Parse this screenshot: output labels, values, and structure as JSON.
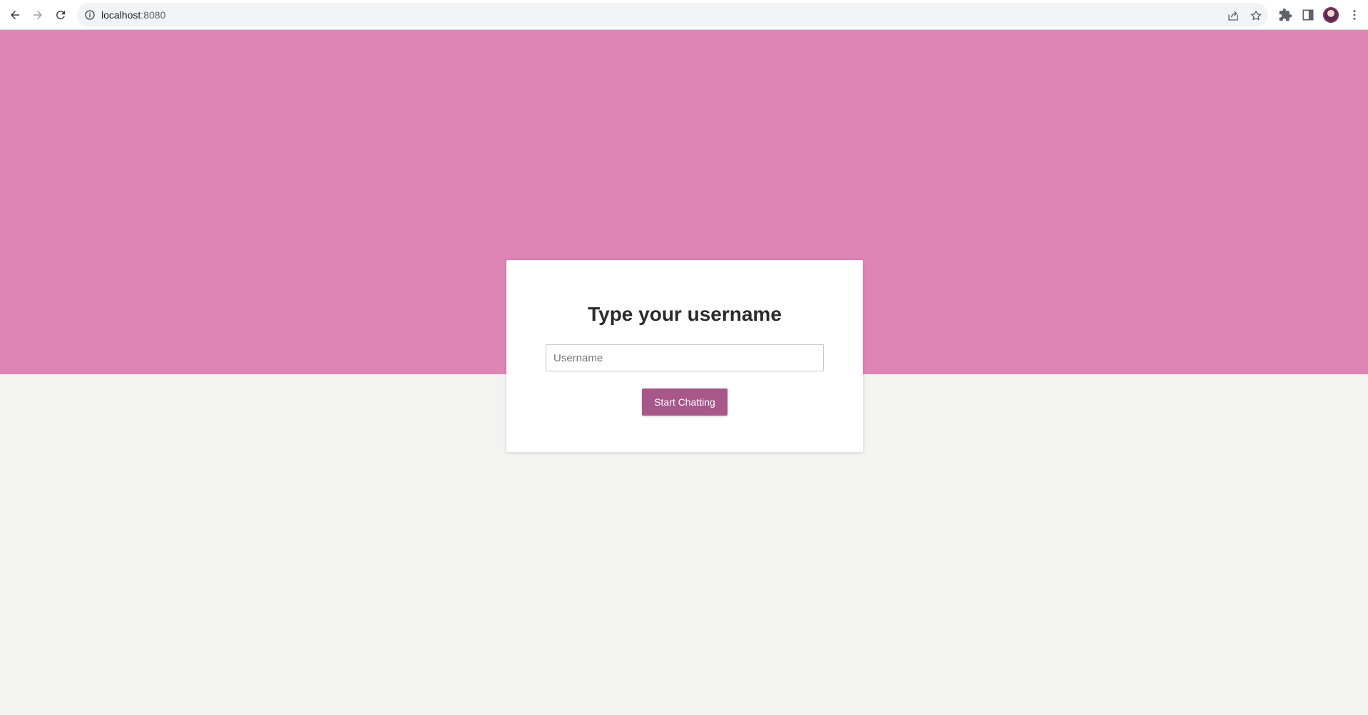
{
  "browser": {
    "url_host": "localhost",
    "url_port": ":8080",
    "icons": {
      "back": "back-arrow-icon",
      "forward": "forward-arrow-icon",
      "reload": "reload-icon",
      "info": "info-icon",
      "share": "share-icon",
      "bookmark": "star-icon",
      "extensions": "puzzle-icon",
      "side_panel": "side-panel-icon",
      "menu": "kebab-menu-icon"
    }
  },
  "page": {
    "colors": {
      "band": "#df85b6",
      "background": "#f3f3f2",
      "button": "#a8578a"
    },
    "login": {
      "title": "Type your username",
      "username_placeholder": "Username",
      "username_value": "",
      "submit_label": "Start Chatting"
    }
  }
}
